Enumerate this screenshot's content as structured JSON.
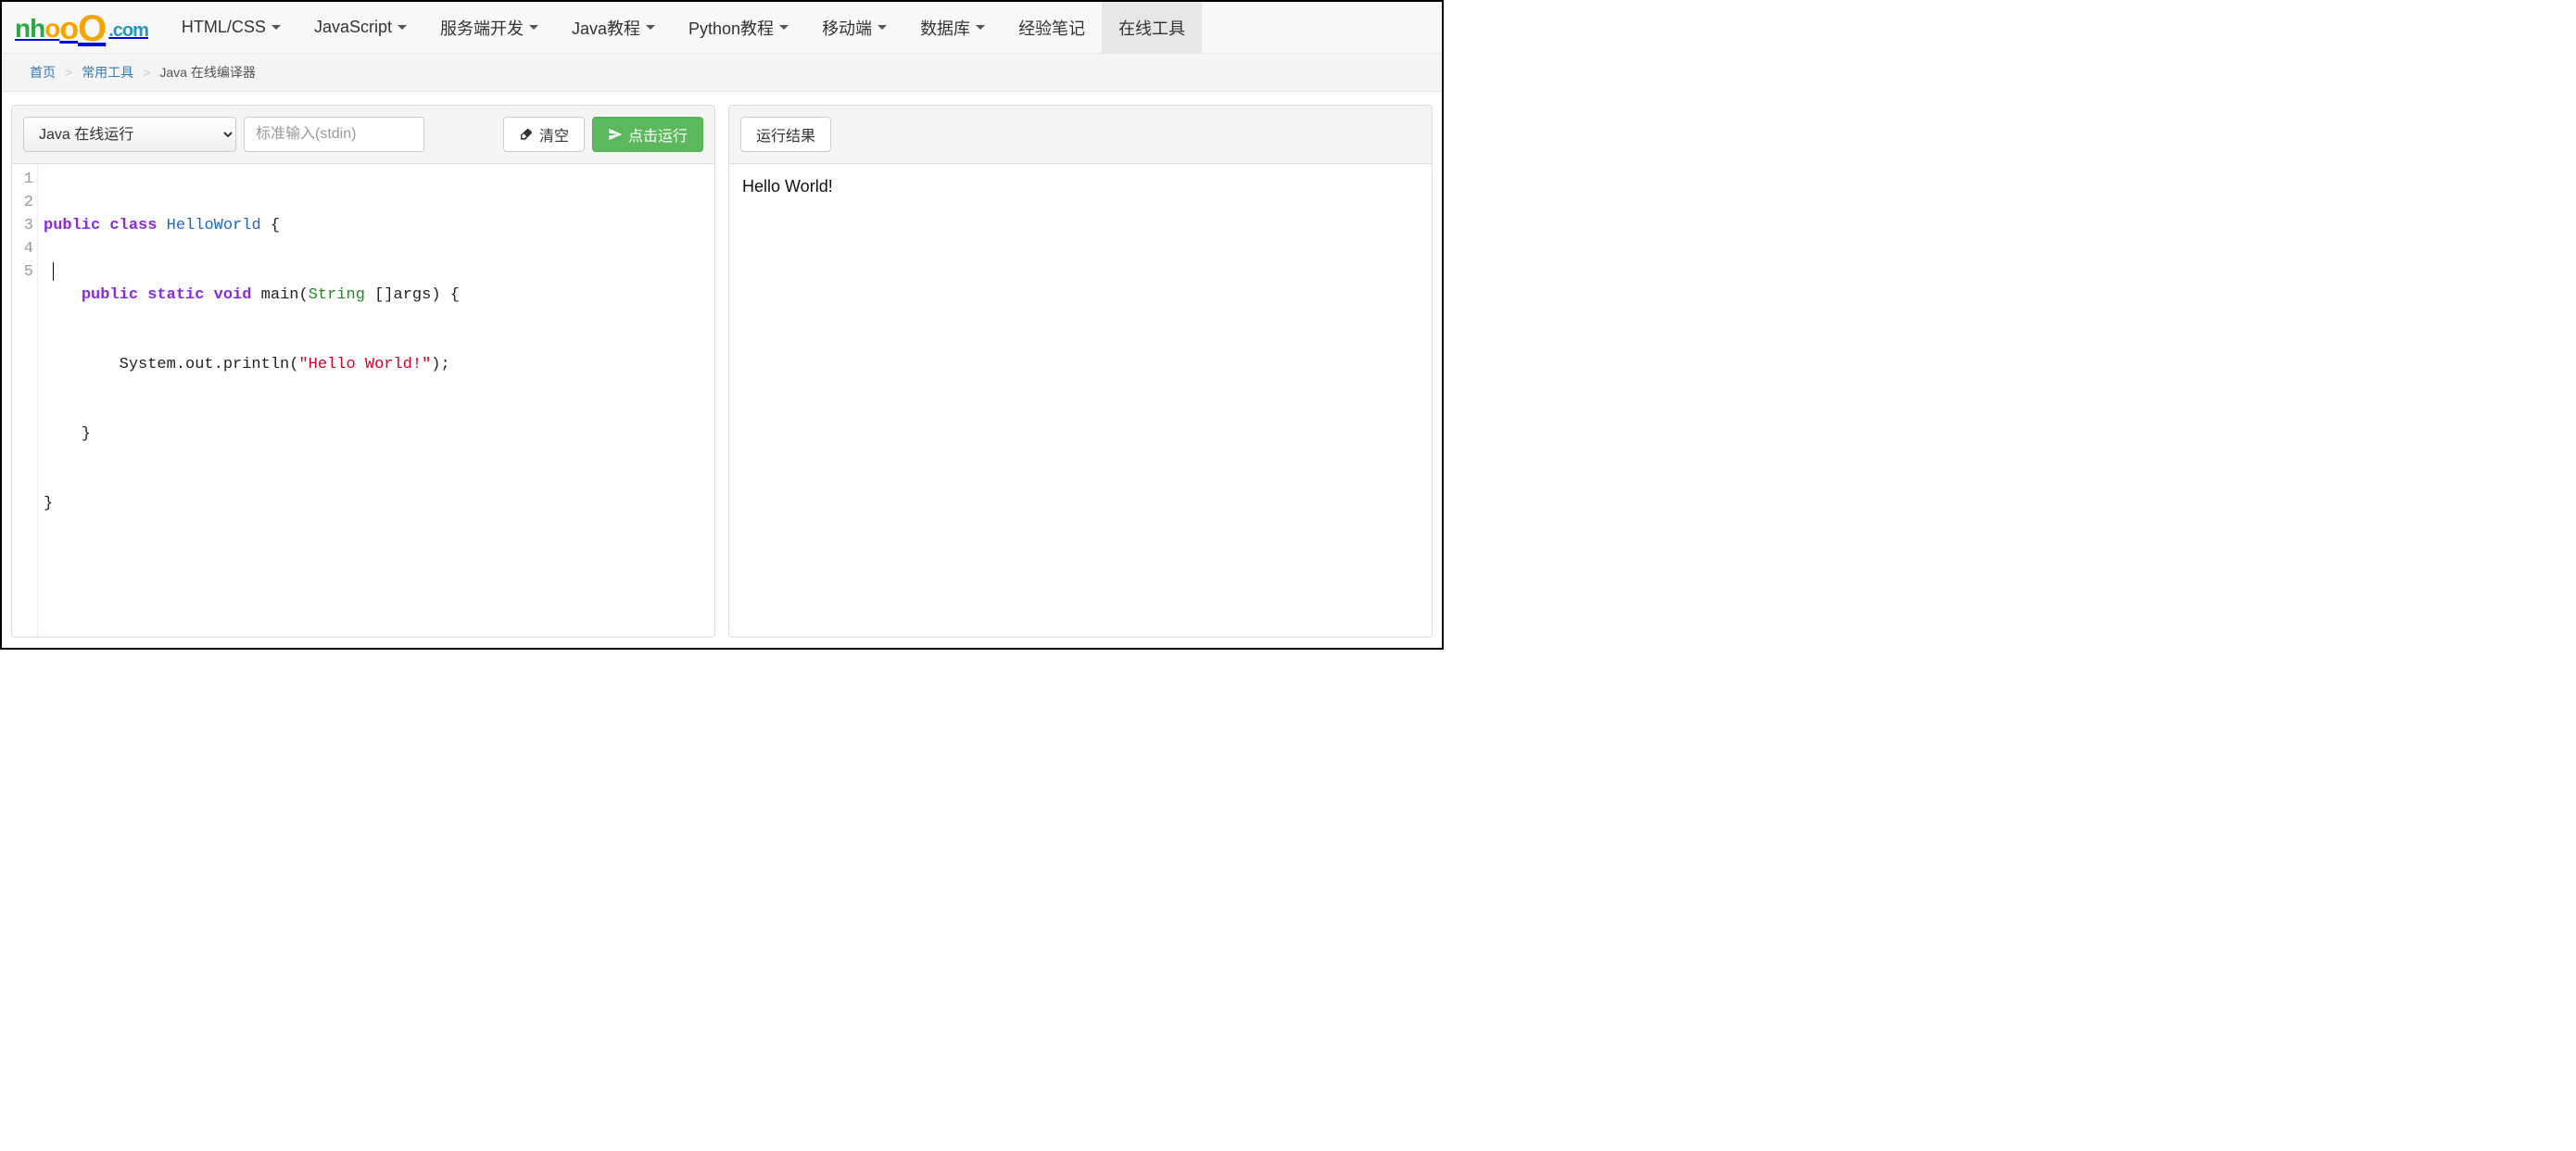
{
  "brand": {
    "nh": "nh",
    "o1": "o",
    "o2": "o",
    "o3": "O",
    "dom": ".com"
  },
  "nav": {
    "items": [
      {
        "label": "HTML/CSS",
        "has_caret": true,
        "active": false
      },
      {
        "label": "JavaScript",
        "has_caret": true,
        "active": false
      },
      {
        "label": "服务端开发",
        "has_caret": true,
        "active": false
      },
      {
        "label": "Java教程",
        "has_caret": true,
        "active": false
      },
      {
        "label": "Python教程",
        "has_caret": true,
        "active": false
      },
      {
        "label": "移动端",
        "has_caret": true,
        "active": false
      },
      {
        "label": "数据库",
        "has_caret": true,
        "active": false
      },
      {
        "label": "经验笔记",
        "has_caret": false,
        "active": false
      },
      {
        "label": "在线工具",
        "has_caret": false,
        "active": true
      }
    ]
  },
  "breadcrumb": [
    {
      "label": "首页",
      "link": true
    },
    {
      "label": "常用工具",
      "link": true
    },
    {
      "label": "Java 在线编译器",
      "link": false
    }
  ],
  "editor": {
    "lang_selected": "Java 在线运行",
    "stdin_placeholder": "标准输入(stdin)",
    "clear_label": "清空",
    "run_label": "点击运行",
    "line_numbers": [
      "1",
      "2",
      "3",
      "4",
      "5"
    ],
    "code": {
      "l1": {
        "a": "public",
        "b": "class",
        "c": "HelloWorld",
        "d": " {"
      },
      "l2": {
        "a": "    ",
        "b": "public",
        "c": "static",
        "d": "void",
        "e": "main",
        "f": "(",
        "g": "String",
        "h": " []args) {"
      },
      "l3": {
        "a": "        System.out.println(",
        "b": "\"Hello World!\"",
        "c": ");"
      },
      "l4": "    }",
      "l5": "}"
    }
  },
  "output": {
    "result_label": "运行结果",
    "text": "Hello World!"
  }
}
